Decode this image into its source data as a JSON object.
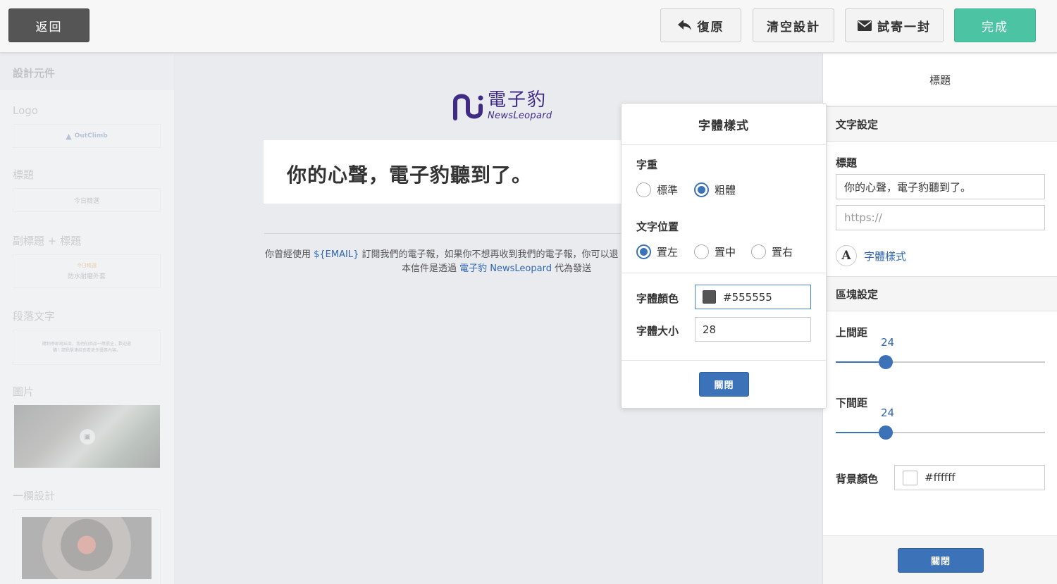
{
  "topbar": {
    "back_label": "返回",
    "undo_label": "復原",
    "clear_label": "清空設計",
    "test_label": "試寄一封",
    "done_label": "完成"
  },
  "sidebar": {
    "heading": "設計元件",
    "items": [
      {
        "label": "Logo",
        "preview": "OutClimb"
      },
      {
        "label": "標題",
        "preview": "今日精選"
      },
      {
        "label": "副標題 + 標題",
        "preview_sub": "今日精選",
        "preview": "防水耐磨外套"
      },
      {
        "label": "段落文字",
        "preview": "購物季即將結束，我們的商品一應俱全，歡迎選購！請點擊連結查看更多優惠內容。"
      },
      {
        "label": "圖片"
      },
      {
        "label": "一欄設計"
      }
    ]
  },
  "canvas": {
    "logo_cn": "電子豹",
    "logo_en": "NewsLeopard",
    "title": "你的心聲，電子豹聽到了。",
    "footer_line1_pre": "你曾經使用 ",
    "footer_email_var": "${EMAIL}",
    "footer_line1_post": " 訂閱我們的電子報，如果你不想再收到我們的電子報，你可以退",
    "footer_line2_pre": "本信件是透過 ",
    "footer_line2_link": "電子豹 NewsLeopard",
    "footer_line2_post": " 代為發送"
  },
  "popover": {
    "title": "字體樣式",
    "weight_label": "字重",
    "weight_options": [
      "標準",
      "粗體"
    ],
    "weight_selected": "粗體",
    "align_label": "文字位置",
    "align_options": [
      "置左",
      "置中",
      "置右"
    ],
    "align_selected": "置左",
    "color_label": "字體顏色",
    "color_value": "#555555",
    "size_label": "字體大小",
    "size_value": "28",
    "close_label": "關閉"
  },
  "panel": {
    "title": "標題",
    "text_section": "文字設定",
    "title_label": "標題",
    "title_value": "你的心聲，電子豹聽到了。",
    "url_placeholder": "https://",
    "font_style_link": "字體樣式",
    "block_section": "區塊設定",
    "top_padding_label": "上間距",
    "top_padding_value": "24",
    "bottom_padding_label": "下間距",
    "bottom_padding_value": "24",
    "bg_color_label": "背景顏色",
    "bg_color_value": "#ffffff",
    "close_label": "關閉"
  },
  "colors": {
    "accent_blue": "#3b72b8",
    "done_green": "#4cc3a3",
    "brand_purple": "#3f2a86",
    "font_color": "#555555",
    "bg_color": "#ffffff"
  },
  "icons": {
    "undo": "reply-arrow-icon",
    "test": "envelope-icon",
    "font_style": "letter-a-icon"
  }
}
